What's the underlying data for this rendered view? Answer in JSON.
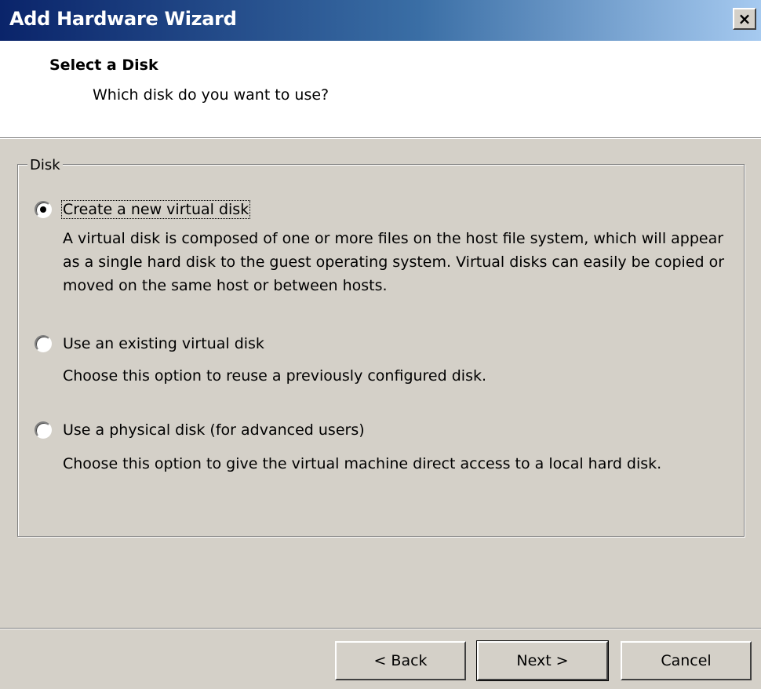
{
  "window": {
    "title": "Add Hardware Wizard",
    "close_label": "×"
  },
  "header": {
    "title": "Select a Disk",
    "subtitle": "Which disk do you want to use?"
  },
  "disk_group": {
    "label": "Disk",
    "options": [
      {
        "label": "Create a new virtual disk",
        "selected": true,
        "description": "A virtual disk is composed of one or more files on the host file system, which will appear as a single hard disk to the guest operating system. Virtual disks can easily be copied or moved on the same host or between hosts."
      },
      {
        "label": "Use an existing virtual disk",
        "selected": false,
        "description": "Choose this option to reuse a previously configured disk."
      },
      {
        "label": "Use a physical disk (for advanced users)",
        "selected": false,
        "description": "Choose this option to give the virtual machine direct access to a local hard disk."
      }
    ]
  },
  "buttons": {
    "back": "< Back",
    "next": "Next >",
    "cancel": "Cancel"
  },
  "colors": {
    "dialog_bg": "#d4d0c8",
    "titlebar_start": "#0a246a",
    "titlebar_end": "#a6caf0",
    "header_bg": "#ffffff"
  }
}
